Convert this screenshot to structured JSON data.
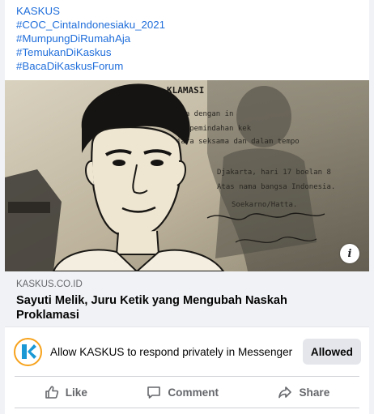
{
  "post": {
    "hashtags": [
      "KASKUS",
      "#COC_CintaIndonesiaku_2021",
      "#MumpungDiRumahAja",
      "#TemukanDiKaskus",
      "#BacaDiKaskusForum"
    ],
    "link": {
      "domain": "KASKUS.CO.ID",
      "title_line1": "Sayuti Melik, Juru Ketik yang Mengubah Naskah",
      "title_line2": "Proklamasi",
      "image_icon": "portrait-illustration",
      "info_icon": "info-icon",
      "image_text": {
        "heading": "KLAMASI",
        "lines": [
          "ata dengan in",
          "ai pemindahan kek",
          "jara seksama dan dalam tempo",
          "Djakarta, hari 17 boelan 8",
          "Atas nama bangsa Indonesia.",
          "Soekarno/Hatta."
        ]
      }
    },
    "messenger": {
      "text": "Allow KASKUS to respond privately in Messenger",
      "button": "Allowed",
      "avatar_icon": "kaskus-logo-icon"
    },
    "actions": [
      {
        "label": "Like",
        "icon": "thumbs-up-icon"
      },
      {
        "label": "Comment",
        "icon": "comment-icon"
      },
      {
        "label": "Share",
        "icon": "share-icon"
      }
    ]
  },
  "colors": {
    "link_blue": "#216fdb",
    "kaskus_orange": "#f7a21b",
    "kaskus_blue": "#1998d5",
    "muted_text": "#65676b"
  }
}
